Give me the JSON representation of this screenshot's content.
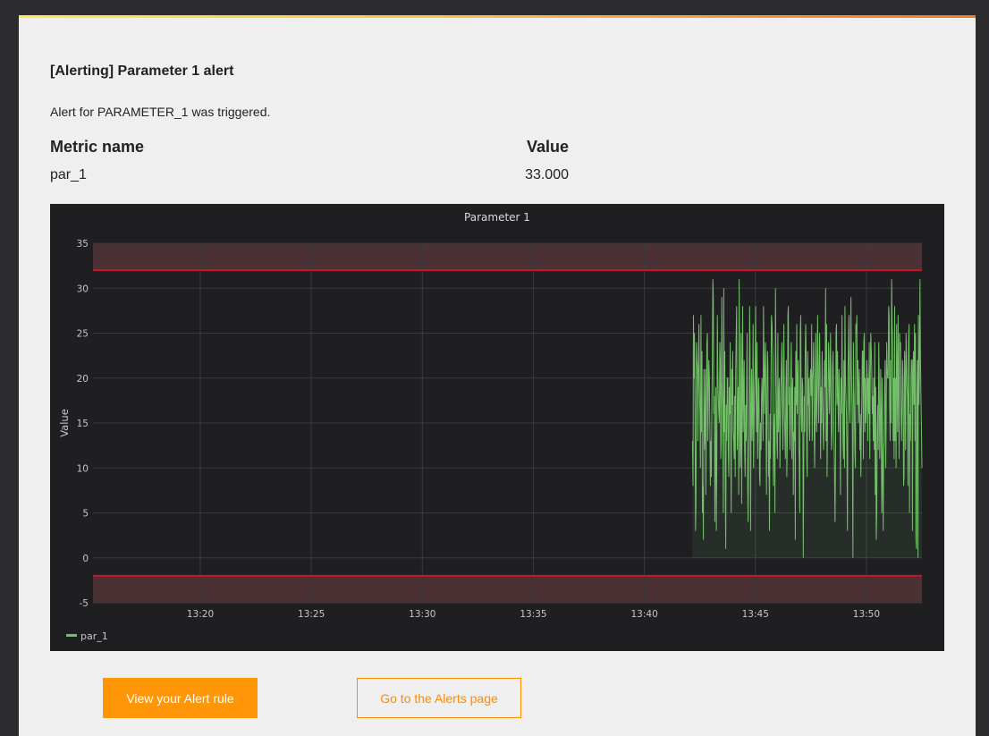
{
  "alert": {
    "title": "[Alerting] Parameter 1 alert",
    "message": "Alert for PARAMETER_1 was triggered.",
    "table": {
      "headers": [
        "Metric name",
        "Value"
      ],
      "rows": [
        {
          "metric": "par_1",
          "value": "33.000"
        }
      ]
    }
  },
  "buttons": {
    "view_rule": "View your Alert rule",
    "alerts_page": "Go to the Alerts page"
  },
  "colors": {
    "accent": "#ff9607",
    "series": "#73bf69",
    "threshold": "#c4162a",
    "panel_bg": "#1f1f22"
  },
  "chart_data": {
    "type": "line",
    "title": "Parameter 1",
    "xlabel": "",
    "ylabel": "Value",
    "x_ticks": [
      "13:20",
      "13:25",
      "13:30",
      "13:35",
      "13:40",
      "13:45",
      "13:50"
    ],
    "y_ticks": [
      -5,
      0,
      5,
      10,
      15,
      20,
      25,
      30,
      35
    ],
    "ylim": [
      -5,
      35
    ],
    "xlim": [
      "13:15:10",
      "13:52:30"
    ],
    "grid": true,
    "legend": "bottom-left",
    "thresholds": [
      {
        "op": "gt",
        "value": 32
      },
      {
        "op": "lt",
        "value": -2
      }
    ],
    "series": [
      {
        "name": "par_1",
        "x_start": "13:42:10",
        "x_end": "13:52:30",
        "values": [
          13,
          8,
          27,
          20,
          25,
          17,
          3,
          6,
          24,
          22,
          21,
          13,
          22,
          26,
          19,
          16,
          10,
          27,
          14,
          23,
          5,
          8,
          2,
          21,
          12,
          14,
          21,
          7,
          17,
          24,
          25,
          13,
          18,
          22,
          20,
          14,
          8,
          13,
          9,
          17,
          22,
          31,
          29,
          16,
          18,
          4,
          11,
          19,
          3,
          10,
          27,
          21,
          18,
          16,
          15,
          24,
          22,
          11,
          13,
          29,
          19,
          17,
          5,
          30,
          14,
          23,
          8,
          1,
          17,
          13,
          20,
          20,
          12,
          9,
          19,
          16,
          24,
          12,
          5,
          21,
          17,
          23,
          14,
          13,
          11,
          18,
          9,
          21,
          25,
          28,
          12,
          16,
          19,
          7,
          31,
          20,
          10,
          13,
          25,
          6,
          20,
          28,
          14,
          18,
          22,
          12,
          9,
          17,
          13,
          20,
          25,
          8,
          4,
          11,
          14,
          28,
          23,
          3,
          17,
          21,
          13,
          16,
          26,
          10,
          15,
          19,
          21,
          28,
          18,
          14,
          24,
          11,
          14,
          20,
          19,
          9,
          8,
          15,
          12,
          18,
          20,
          17,
          13,
          28,
          22,
          16,
          21,
          24,
          15,
          7,
          18,
          23,
          21,
          9,
          13,
          3,
          16,
          11,
          19,
          27,
          26,
          24,
          22,
          8,
          14,
          16,
          5,
          30,
          23,
          18,
          13,
          11,
          25,
          14,
          18,
          20,
          10,
          15,
          19,
          21,
          24,
          17,
          12,
          20,
          26,
          16,
          14,
          11,
          18,
          22,
          9,
          13,
          27,
          28,
          17,
          19,
          12,
          15,
          21,
          24,
          11,
          18,
          20,
          7,
          14,
          13,
          19,
          2,
          23,
          17,
          26,
          16,
          20,
          22,
          12,
          11,
          5,
          25,
          27,
          16,
          14,
          20,
          19,
          0,
          10,
          18,
          14,
          23,
          26,
          22,
          11,
          9,
          23,
          17,
          20,
          15,
          13,
          20,
          21,
          18,
          26,
          13,
          20,
          21,
          24,
          14,
          10,
          17,
          25,
          16,
          14,
          22,
          27,
          19,
          15,
          21,
          25,
          20,
          11,
          19,
          15,
          23,
          18,
          14,
          12,
          17,
          22,
          19,
          30,
          13,
          26,
          9,
          15,
          18,
          24,
          22,
          16,
          20,
          25,
          17,
          12,
          14,
          21,
          23,
          19,
          13,
          9,
          4,
          11,
          25,
          26,
          17,
          23,
          18,
          14,
          21,
          18,
          15,
          7,
          20,
          16,
          27,
          19,
          13,
          11,
          22,
          10,
          28,
          20,
          18,
          16,
          12,
          3,
          21,
          23,
          27,
          17,
          15,
          20,
          29,
          21,
          18,
          14,
          0,
          24,
          19,
          16,
          12,
          10,
          26,
          25,
          27,
          17,
          22,
          15,
          19,
          21,
          12,
          16,
          9,
          14,
          18,
          23,
          23,
          11,
          24,
          25,
          14,
          20,
          15,
          17,
          22,
          20,
          13,
          20,
          16,
          24,
          11,
          20,
          25,
          23,
          21,
          16,
          18,
          13,
          20,
          12,
          24,
          7,
          19,
          2,
          5,
          14,
          17,
          12,
          24,
          20,
          11,
          13,
          21,
          16,
          5,
          20,
          9,
          3,
          12,
          13,
          19,
          22,
          10,
          15,
          24,
          21,
          20,
          20,
          28,
          27,
          17,
          13,
          22,
          15,
          31,
          26,
          24,
          13,
          20,
          11,
          28,
          13,
          20,
          10,
          26,
          21,
          14,
          27,
          18,
          11,
          25,
          23,
          24,
          16,
          13,
          17,
          22,
          20,
          8,
          9,
          23,
          20,
          12,
          25,
          22,
          19,
          18,
          8,
          24,
          26,
          5,
          16,
          13,
          20,
          22,
          22,
          3,
          21,
          23,
          17,
          26,
          13,
          25,
          2,
          1,
          18,
          22,
          0,
          27,
          17,
          20,
          31,
          23,
          18,
          15,
          10
        ]
      }
    ]
  }
}
